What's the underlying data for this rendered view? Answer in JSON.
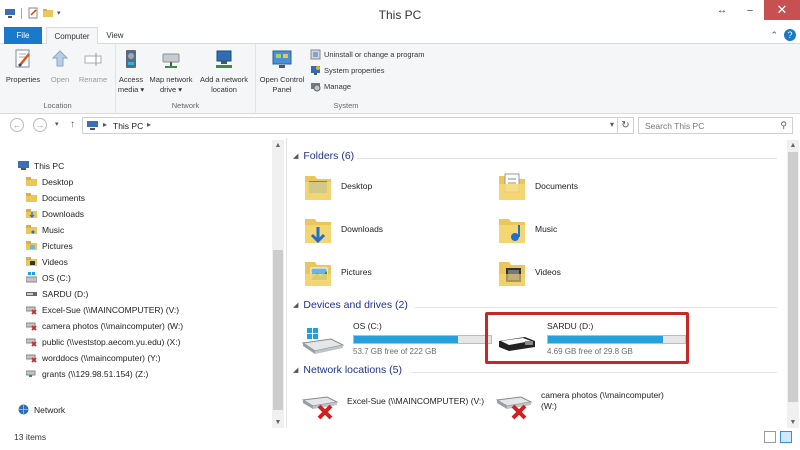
{
  "window": {
    "title": "This PC",
    "restore_glyph": "↔",
    "minimize_glyph": "–",
    "close_glyph": "✕"
  },
  "ribbon_tabs": [
    {
      "label": "File",
      "active": false
    },
    {
      "label": "Computer",
      "active": true
    },
    {
      "label": "View",
      "active": false
    }
  ],
  "ribbon": {
    "location": {
      "group_label": "Location",
      "buttons": [
        {
          "label": "Properties",
          "icon": "properties-icon",
          "enabled": true
        },
        {
          "label": "Open",
          "icon": "open-icon",
          "enabled": false
        },
        {
          "label": "Rename",
          "icon": "rename-icon",
          "enabled": false
        }
      ]
    },
    "network": {
      "group_label": "Network",
      "buttons": [
        {
          "label1": "Access",
          "label2": "media ▾",
          "icon": "access-media-icon"
        },
        {
          "label1": "Map network",
          "label2": "drive ▾",
          "icon": "map-drive-icon"
        },
        {
          "label1": "Add a network",
          "label2": "location",
          "icon": "add-network-location-icon"
        }
      ]
    },
    "system": {
      "group_label": "System",
      "open_cp": {
        "label1": "Open Control",
        "label2": "Panel",
        "icon": "control-panel-icon"
      },
      "small": [
        {
          "label": "Uninstall or change a program",
          "icon": "uninstall-icon"
        },
        {
          "label": "System properties",
          "icon": "system-properties-icon"
        },
        {
          "label": "Manage",
          "icon": "manage-icon"
        }
      ]
    }
  },
  "address": {
    "crumb": "This PC",
    "search_placeholder": "Search This PC"
  },
  "nav_pane": {
    "root": "This PC",
    "items": [
      {
        "label": "Desktop",
        "icon": "folder-icon"
      },
      {
        "label": "Documents",
        "icon": "folder-icon"
      },
      {
        "label": "Downloads",
        "icon": "folder-icon"
      },
      {
        "label": "Music",
        "icon": "folder-icon"
      },
      {
        "label": "Pictures",
        "icon": "folder-icon"
      },
      {
        "label": "Videos",
        "icon": "folder-icon"
      },
      {
        "label": "OS (C:)",
        "icon": "windows-drive-icon"
      },
      {
        "label": "SARDU (D:)",
        "icon": "usb-drive-icon"
      },
      {
        "label": "Excel-Sue (\\\\MAINCOMPUTER) (V:)",
        "icon": "disconnected-network-drive-icon"
      },
      {
        "label": "camera photos (\\\\maincomputer) (W:)",
        "icon": "disconnected-network-drive-icon"
      },
      {
        "label": "public (\\\\veststop.aecom.yu.edu) (X:)",
        "icon": "disconnected-network-drive-icon"
      },
      {
        "label": "worddocs (\\\\maincomputer) (Y:)",
        "icon": "disconnected-network-drive-icon"
      },
      {
        "label": "grants (\\\\129.98.51.154) (Z:)",
        "icon": "network-drive-icon"
      }
    ],
    "network": "Network"
  },
  "content": {
    "folders_header": "Folders (6)",
    "folders": [
      {
        "label": "Desktop",
        "icon": "desktop-folder-icon"
      },
      {
        "label": "Documents",
        "icon": "documents-folder-icon"
      },
      {
        "label": "Downloads",
        "icon": "downloads-folder-icon"
      },
      {
        "label": "Music",
        "icon": "music-folder-icon"
      },
      {
        "label": "Pictures",
        "icon": "pictures-folder-icon"
      },
      {
        "label": "Videos",
        "icon": "videos-folder-icon"
      }
    ],
    "devices_header": "Devices and drives (2)",
    "drives": [
      {
        "name": "OS (C:)",
        "free": "53.7 GB free of 222 GB",
        "used_fraction": 0.76,
        "icon": "windows-drive-icon"
      },
      {
        "name": "SARDU (D:)",
        "free": "4.69 GB free of 29.8 GB",
        "used_fraction": 0.84,
        "icon": "usb-drive-icon"
      }
    ],
    "network_header": "Network locations (5)",
    "network_locations": [
      {
        "label": "Excel-Sue (\\\\MAINCOMPUTER) (V:)",
        "icon": "disconnected-network-drive-icon"
      },
      {
        "label": "camera photos (\\\\maincomputer)\n(W:)",
        "icon": "disconnected-network-drive-icon"
      }
    ]
  },
  "status": {
    "item_count": "13 items"
  },
  "colors": {
    "accent": "#1979ca",
    "section_header": "#1e3287",
    "drive_bar": "#26a0da",
    "highlight_box": "#c62828",
    "close_button": "#c75050"
  }
}
